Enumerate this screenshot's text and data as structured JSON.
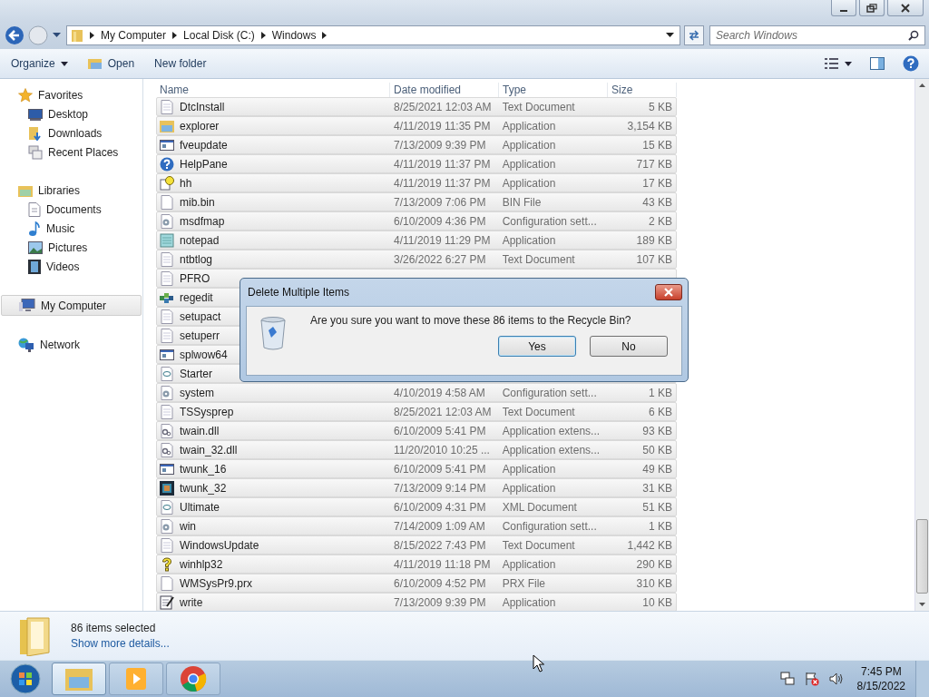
{
  "address": {
    "crumbs": [
      "My Computer",
      "Local Disk (C:)",
      "Windows"
    ]
  },
  "search": {
    "placeholder": "Search Windows"
  },
  "toolbar": {
    "buttons": [
      {
        "label": "Organize",
        "kind": "menu"
      },
      {
        "label": "Open",
        "kind": "open"
      },
      {
        "label": "New folder",
        "kind": "plain"
      }
    ]
  },
  "sidebar": {
    "groups": [
      {
        "label": "Favorites",
        "kind": "star",
        "selected": false,
        "children": [
          {
            "label": "Desktop",
            "kind": "desktop",
            "selected": false
          },
          {
            "label": "Downloads",
            "kind": "downloads",
            "selected": false
          },
          {
            "label": "Recent Places",
            "kind": "recent",
            "selected": false
          }
        ]
      },
      {
        "label": "Libraries",
        "kind": "libraries",
        "selected": false,
        "children": [
          {
            "label": "Documents",
            "kind": "documents",
            "selected": false
          },
          {
            "label": "Music",
            "kind": "music",
            "selected": false
          },
          {
            "label": "Pictures",
            "kind": "pictures",
            "selected": false
          },
          {
            "label": "Videos",
            "kind": "videos",
            "selected": false
          }
        ]
      },
      {
        "label": "My Computer",
        "kind": "computer",
        "selected": true
      },
      {
        "label": "Network",
        "kind": "network",
        "selected": false
      }
    ]
  },
  "table": {
    "columns": [
      "Name",
      "Date modified",
      "Type",
      "Size"
    ],
    "rows": [
      {
        "kind": "text",
        "selected": true,
        "name": "DtcInstall",
        "date": "8/25/2021 12:03 AM",
        "type": "Text Document",
        "size": "5 KB"
      },
      {
        "kind": "folder",
        "selected": true,
        "name": "explorer",
        "date": "4/11/2019 11:35 PM",
        "type": "Application",
        "size": "3,154 KB"
      },
      {
        "kind": "window",
        "selected": true,
        "name": "fveupdate",
        "date": "7/13/2009 9:39 PM",
        "type": "Application",
        "size": "15 KB"
      },
      {
        "kind": "help",
        "selected": true,
        "name": "HelpPane",
        "date": "4/11/2019 11:37 PM",
        "type": "Application",
        "size": "717 KB"
      },
      {
        "kind": "question",
        "selected": true,
        "name": "hh",
        "date": "4/11/2019 11:37 PM",
        "type": "Application",
        "size": "17 KB"
      },
      {
        "kind": "blank",
        "selected": true,
        "name": "mib.bin",
        "date": "7/13/2009 7:06 PM",
        "type": "BIN File",
        "size": "43 KB"
      },
      {
        "kind": "config",
        "selected": true,
        "name": "msdfmap",
        "date": "6/10/2009 4:36 PM",
        "type": "Configuration sett...",
        "size": "2 KB"
      },
      {
        "kind": "notepad",
        "selected": true,
        "name": "notepad",
        "date": "4/11/2019 11:29 PM",
        "type": "Application",
        "size": "189 KB"
      },
      {
        "kind": "text",
        "selected": true,
        "name": "ntbtlog",
        "date": "3/26/2022 6:27 PM",
        "type": "Text Document",
        "size": "107 KB"
      },
      {
        "kind": "text",
        "selected": true,
        "name": "PFRO"
      },
      {
        "kind": "regedit",
        "selected": true,
        "name": "regedit"
      },
      {
        "kind": "text",
        "selected": true,
        "name": "setupact"
      },
      {
        "kind": "text",
        "selected": true,
        "name": "setuperr"
      },
      {
        "kind": "window",
        "selected": true,
        "name": "splwow64"
      },
      {
        "kind": "xml",
        "selected": true,
        "name": "Starter"
      },
      {
        "kind": "config",
        "selected": true,
        "name": "system",
        "date": "4/10/2019 4:58 AM",
        "type": "Configuration sett...",
        "size": "1 KB"
      },
      {
        "kind": "text",
        "selected": true,
        "name": "TSSysprep",
        "date": "8/25/2021 12:03 AM",
        "type": "Text Document",
        "size": "6 KB"
      },
      {
        "kind": "dll",
        "selected": true,
        "name": "twain.dll",
        "date": "6/10/2009 5:41 PM",
        "type": "Application extens...",
        "size": "93 KB"
      },
      {
        "kind": "dll",
        "selected": true,
        "name": "twain_32.dll",
        "date": "11/20/2010 10:25 ...",
        "type": "Application extens...",
        "size": "50 KB"
      },
      {
        "kind": "window",
        "selected": true,
        "name": "twunk_16",
        "date": "6/10/2009 5:41 PM",
        "type": "Application",
        "size": "49 KB"
      },
      {
        "kind": "dark",
        "selected": true,
        "name": "twunk_32",
        "date": "7/13/2009 9:14 PM",
        "type": "Application",
        "size": "31 KB"
      },
      {
        "kind": "xml",
        "selected": true,
        "name": "Ultimate",
        "date": "6/10/2009 4:31 PM",
        "type": "XML Document",
        "size": "51 KB"
      },
      {
        "kind": "config",
        "selected": true,
        "name": "win",
        "date": "7/14/2009 1:09 AM",
        "type": "Configuration sett...",
        "size": "1 KB"
      },
      {
        "kind": "text",
        "selected": true,
        "name": "WindowsUpdate",
        "date": "8/15/2022 7:43 PM",
        "type": "Text Document",
        "size": "1,442 KB"
      },
      {
        "kind": "winhelp",
        "selected": true,
        "name": "winhlp32",
        "date": "4/11/2019 11:18 PM",
        "type": "Application",
        "size": "290 KB"
      },
      {
        "kind": "blank",
        "selected": true,
        "name": "WMSysPr9.prx",
        "date": "6/10/2009 4:52 PM",
        "type": "PRX File",
        "size": "310 KB"
      },
      {
        "kind": "write",
        "selected": true,
        "name": "write",
        "date": "7/13/2009 9:39 PM",
        "type": "Application",
        "size": "10 KB"
      }
    ]
  },
  "dialog": {
    "title": "Delete Multiple Items",
    "message": "Are you sure you want to move these 86 items to the Recycle Bin?",
    "buttons": [
      {
        "label": "Yes",
        "selected": true
      },
      {
        "label": "No",
        "selected": false
      }
    ]
  },
  "details": {
    "summary": "86 items selected",
    "link": "Show more details..."
  },
  "taskbar": {
    "apps": [
      {
        "kind": "explorer",
        "selected": true
      },
      {
        "kind": "media",
        "selected": false
      },
      {
        "kind": "chrome",
        "selected": false
      }
    ],
    "time": "7:45 PM",
    "date": "8/15/2022"
  }
}
